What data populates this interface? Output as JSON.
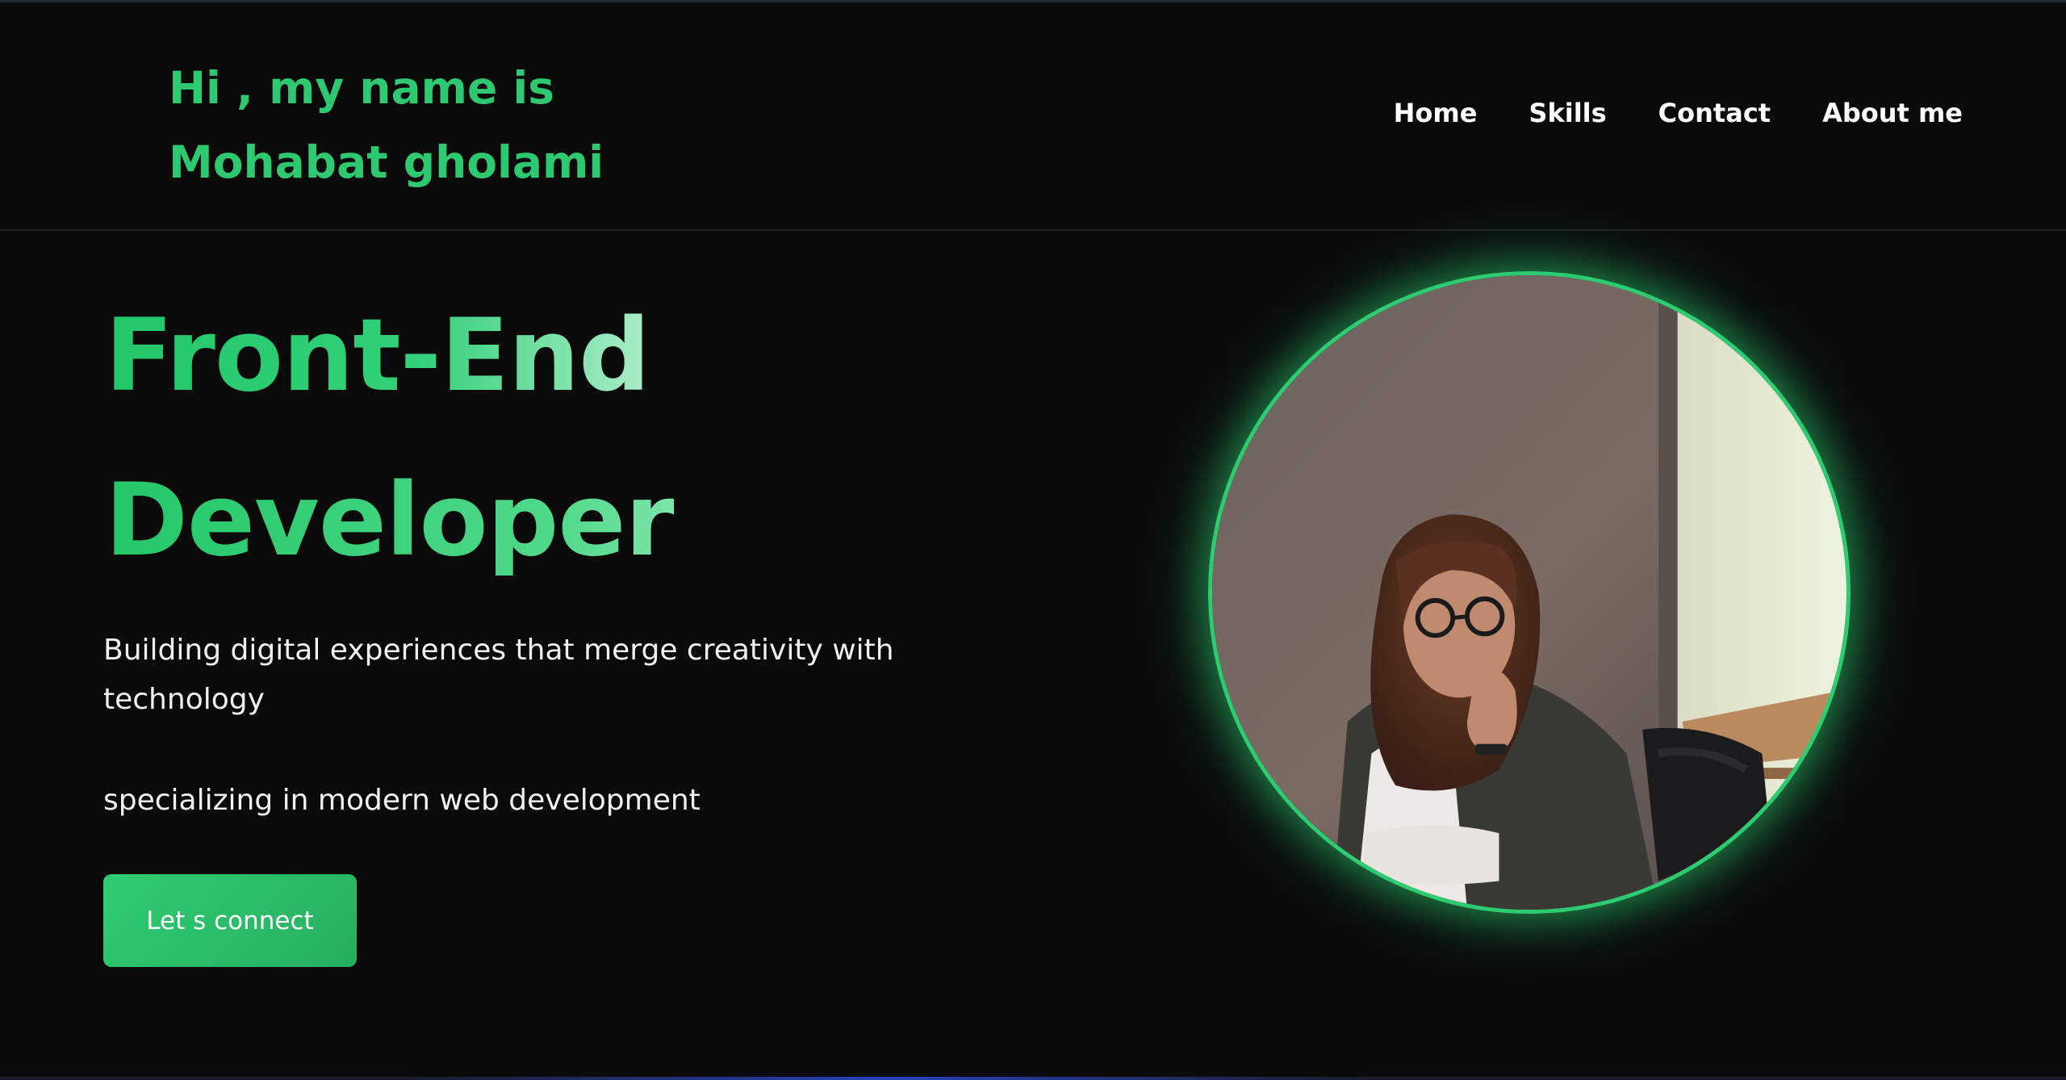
{
  "header": {
    "greeting_line1": "Hi , my name is",
    "greeting_line2": "Mohabat gholami",
    "nav": [
      {
        "label": "Home"
      },
      {
        "label": "Skills"
      },
      {
        "label": "Contact"
      },
      {
        "label": "About me"
      }
    ]
  },
  "hero": {
    "title_line1": "Front-End",
    "title_line2": "Developer",
    "description": "Building digital experiences that merge creativity with technology",
    "description2": "specializing in modern web development",
    "cta_label": "Let s connect"
  },
  "photo": {
    "alt_icon": "profile-photo"
  },
  "colors": {
    "accent": "#2ecc71",
    "background": "#0a0a0a",
    "text": "#ffffff"
  }
}
